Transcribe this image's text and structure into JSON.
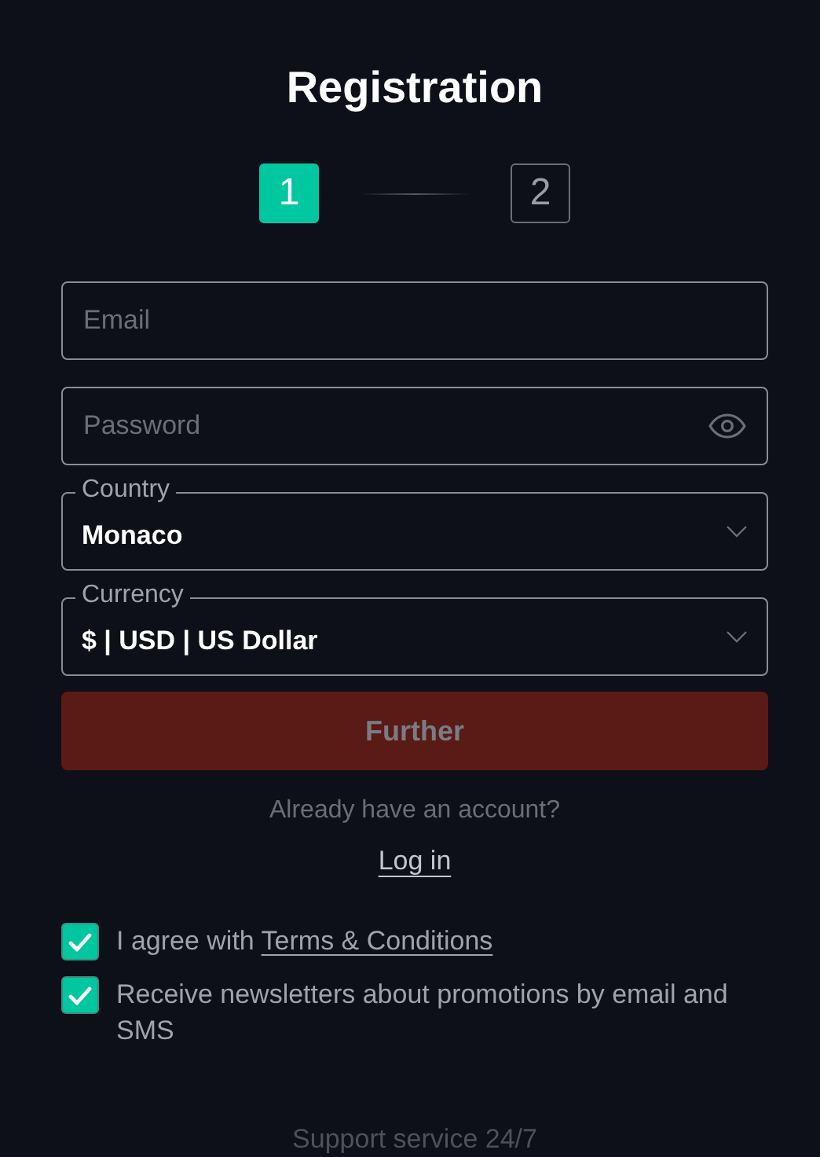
{
  "title": "Registration",
  "steps": [
    {
      "label": "1",
      "selected": true
    },
    {
      "label": "2",
      "selected": false
    }
  ],
  "fields": [
    {
      "kind": "input",
      "placeholder": "Email"
    },
    {
      "kind": "password",
      "placeholder": "Password"
    },
    {
      "kind": "select",
      "label": "Country",
      "value": "Monaco"
    },
    {
      "kind": "select",
      "label": "Currency",
      "value": "$ | USD | US Dollar"
    }
  ],
  "submit": {
    "label": "Further",
    "disabled": true
  },
  "login_prompt": "Already have an account?",
  "login_link": "Log in",
  "consents": [
    {
      "text": "I agree with ",
      "link": "Terms & Conditions",
      "checked": true
    },
    {
      "text": "Receive newsletters about promotions by email and SMS",
      "checked": true
    }
  ],
  "footer": "Support service 24/7"
}
